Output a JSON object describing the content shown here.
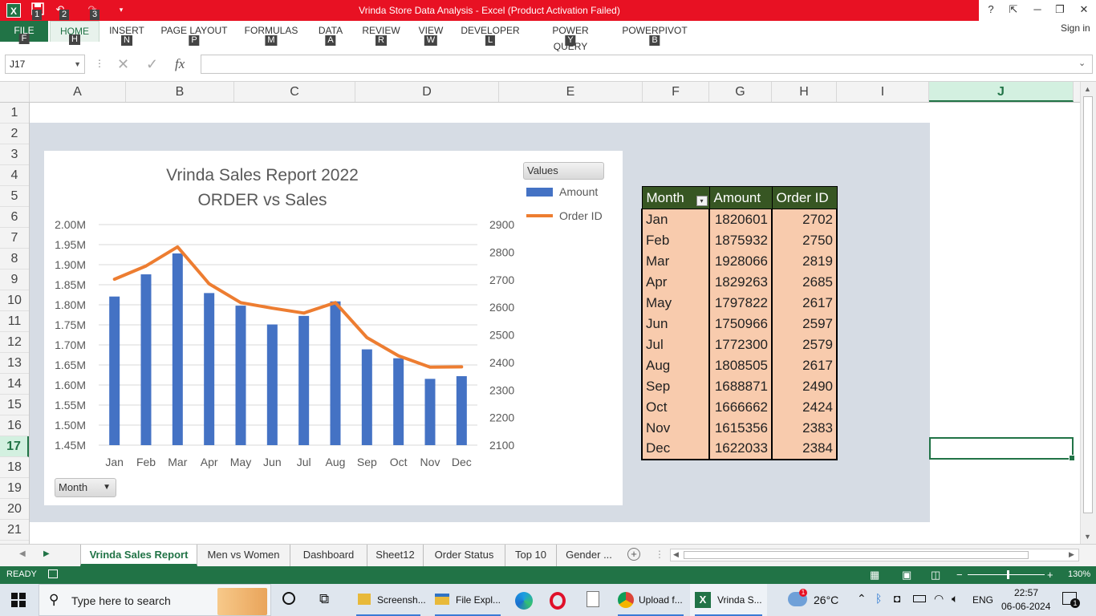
{
  "window": {
    "title": "Vrinda Store Data Analysis -  Excel (Product Activation Failed)",
    "help": "?",
    "signin": "Sign in",
    "qat_keytips": [
      "1",
      "2",
      "3"
    ]
  },
  "ribbon": {
    "tabs": [
      {
        "label": "FILE",
        "key": "F"
      },
      {
        "label": "HOME",
        "key": "H"
      },
      {
        "label": "INSERT",
        "key": "N"
      },
      {
        "label": "PAGE LAYOUT",
        "key": "P"
      },
      {
        "label": "FORMULAS",
        "key": "M"
      },
      {
        "label": "DATA",
        "key": "A"
      },
      {
        "label": "REVIEW",
        "key": "R"
      },
      {
        "label": "VIEW",
        "key": "W"
      },
      {
        "label": "DEVELOPER",
        "key": "L"
      },
      {
        "label": "POWER QUERY",
        "key": "Y"
      },
      {
        "label": "POWERPIVOT",
        "key": "B"
      }
    ]
  },
  "formula_bar": {
    "name_box": "J17",
    "fx": "fx",
    "content": ""
  },
  "grid": {
    "columns": [
      "A",
      "B",
      "C",
      "D",
      "E",
      "F",
      "G",
      "H",
      "I",
      "J"
    ],
    "rows": [
      "1",
      "2",
      "3",
      "4",
      "5",
      "6",
      "7",
      "8",
      "9",
      "10",
      "11",
      "12",
      "13",
      "14",
      "15",
      "16",
      "17",
      "18",
      "19",
      "20",
      "21"
    ],
    "selected_column": "J",
    "selected_row": "17"
  },
  "chart": {
    "values_button": "Values",
    "month_button": "Month"
  },
  "chart_data": {
    "type": "bar",
    "title": "Vrinda Sales Report 2022",
    "subtitle": "ORDER vs Sales",
    "categories": [
      "Jan",
      "Feb",
      "Mar",
      "Apr",
      "May",
      "Jun",
      "Jul",
      "Aug",
      "Sep",
      "Oct",
      "Nov",
      "Dec"
    ],
    "series": [
      {
        "name": "Amount",
        "type": "bar",
        "axis": "left",
        "color": "#4472c4",
        "values": [
          1820601,
          1875932,
          1928066,
          1829263,
          1797822,
          1750966,
          1772300,
          1808505,
          1688871,
          1666662,
          1615356,
          1622033
        ]
      },
      {
        "name": "Order ID",
        "type": "line",
        "axis": "right",
        "color": "#ed7d31",
        "values": [
          2702,
          2750,
          2819,
          2685,
          2617,
          2597,
          2579,
          2617,
          2490,
          2424,
          2383,
          2384
        ]
      }
    ],
    "y_left": {
      "min": 1450000,
      "max": 2000000,
      "step": 50000,
      "tick_labels": [
        "2.00M",
        "1.95M",
        "1.90M",
        "1.85M",
        "1.80M",
        "1.75M",
        "1.70M",
        "1.65M",
        "1.60M",
        "1.55M",
        "1.50M",
        "1.45M"
      ]
    },
    "y_right": {
      "min": 2100,
      "max": 2900,
      "step": 100,
      "tick_labels": [
        "2900",
        "2800",
        "2700",
        "2600",
        "2500",
        "2400",
        "2300",
        "2200",
        "2100"
      ]
    },
    "grid": true,
    "legend": "right"
  },
  "table": {
    "headers": [
      "Month",
      "Amount",
      "Order ID"
    ],
    "rows": [
      [
        "Jan",
        "1820601",
        "2702"
      ],
      [
        "Feb",
        "1875932",
        "2750"
      ],
      [
        "Mar",
        "1928066",
        "2819"
      ],
      [
        "Apr",
        "1829263",
        "2685"
      ],
      [
        "May",
        "1797822",
        "2617"
      ],
      [
        "Jun",
        "1750966",
        "2597"
      ],
      [
        "Jul",
        "1772300",
        "2579"
      ],
      [
        "Aug",
        "1808505",
        "2617"
      ],
      [
        "Sep",
        "1688871",
        "2490"
      ],
      [
        "Oct",
        "1666662",
        "2424"
      ],
      [
        "Nov",
        "1615356",
        "2383"
      ],
      [
        "Dec",
        "1622033",
        "2384"
      ]
    ]
  },
  "sheets": {
    "tabs": [
      "Vrinda Sales Report",
      "Men vs Women",
      "Dashboard",
      "Sheet12",
      "Order Status",
      "Top 10",
      "Gender  ..."
    ],
    "active": "Vrinda Sales Report"
  },
  "status": {
    "mode": "READY",
    "zoom": "130%"
  },
  "taskbar": {
    "search_placeholder": "Type here to search",
    "apps": [
      "Screensh...",
      "File Expl...",
      "Upload f...",
      "Vrinda S..."
    ],
    "weather": "26°C",
    "lang": "ENG",
    "time": "22:57",
    "date": "06-06-2024",
    "notification_count": "1",
    "notif_badge": "1"
  }
}
